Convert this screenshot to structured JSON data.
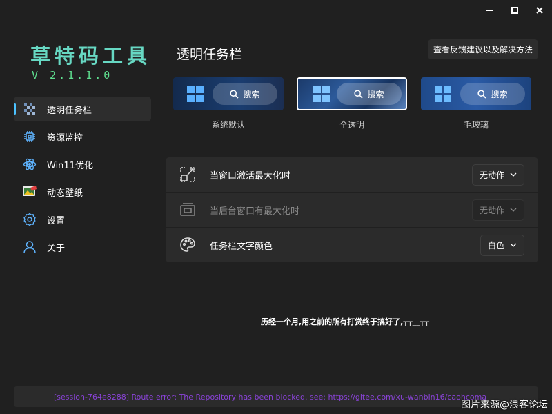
{
  "app": {
    "title": "草特码工具",
    "version": "V 2.1.1.0"
  },
  "window_controls": {
    "minimize_icon": "minimize-icon",
    "maximize_icon": "maximize-icon",
    "close_icon": "close-icon"
  },
  "sidebar": {
    "items": [
      {
        "label": "透明任务栏",
        "icon": "taskbar-icon",
        "active": true
      },
      {
        "label": "资源监控",
        "icon": "chip-icon",
        "active": false
      },
      {
        "label": "Win11优化",
        "icon": "atom-icon",
        "active": false
      },
      {
        "label": "动态壁纸",
        "icon": "wallpaper-icon",
        "active": false
      },
      {
        "label": "设置",
        "icon": "gear-icon",
        "active": false
      },
      {
        "label": "关于",
        "icon": "user-icon",
        "active": false
      }
    ]
  },
  "main": {
    "title": "透明任务栏",
    "feedback_button": "查看反馈建议以及解决方法",
    "previews": [
      {
        "label": "系统默认",
        "search_label": "搜索",
        "selected": false
      },
      {
        "label": "全透明",
        "search_label": "搜索",
        "selected": true
      },
      {
        "label": "毛玻璃",
        "search_label": "搜索",
        "selected": false
      }
    ],
    "settings": [
      {
        "label": "当窗口激活最大化时",
        "value": "无动作",
        "icon": "maximize-window-icon",
        "enabled": true
      },
      {
        "label": "当后台窗口有最大化时",
        "value": "无动作",
        "icon": "background-window-icon",
        "enabled": false
      },
      {
        "label": "任务栏文字颜色",
        "value": "白色",
        "icon": "palette-icon",
        "enabled": true
      }
    ],
    "message": "历经一个月,用之前的所有打赏终于搞好了,┬┬__┬┬"
  },
  "status": {
    "text": "[session-764e8288] Route error: The Repository has been blocked. see: https://gitee.com/xu-wanbin16/caohcoma"
  },
  "watermark": "图片来源@浪客论坛",
  "colors": {
    "background": "#202020",
    "accent": "#4cc2ff",
    "title": "#67d8c3",
    "version": "#5fe090",
    "status_text": "#8a43d8"
  }
}
